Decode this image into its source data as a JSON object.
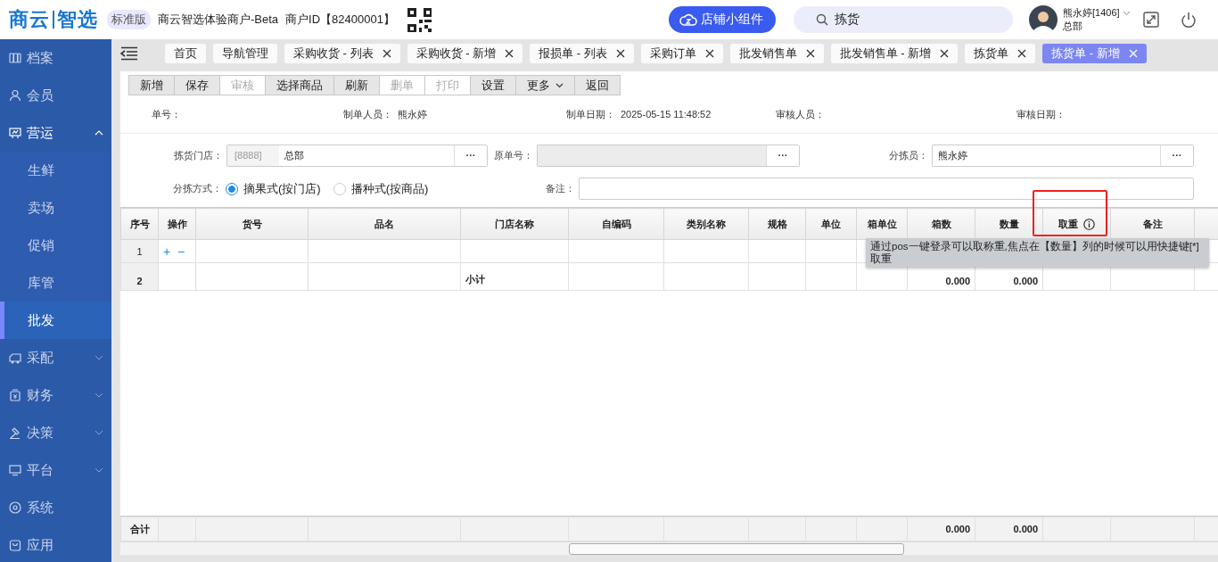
{
  "header": {
    "logo_left": "商云",
    "logo_right": "智选",
    "edition": "标准版",
    "merchant": "商云智选体验商户-Beta",
    "merchant_id": "商户ID【82400001】",
    "widget_button": "店铺小组件",
    "search": {
      "value": "拣货"
    },
    "user": {
      "name": "熊永婷[1406]",
      "org": "总部"
    }
  },
  "sidebar": {
    "items": [
      {
        "label": "档案",
        "expandable": false
      },
      {
        "label": "会员",
        "expandable": false
      },
      {
        "label": "营运",
        "expandable": true,
        "expanded": true,
        "children": [
          {
            "label": "生鲜",
            "selected": false
          },
          {
            "label": "卖场",
            "selected": false
          },
          {
            "label": "促销",
            "selected": false
          },
          {
            "label": "库管",
            "selected": false
          },
          {
            "label": "批发",
            "selected": true
          }
        ]
      },
      {
        "label": "采配",
        "expandable": true,
        "expanded": false
      },
      {
        "label": "财务",
        "expandable": true,
        "expanded": false
      },
      {
        "label": "决策",
        "expandable": true,
        "expanded": false
      },
      {
        "label": "平台",
        "expandable": true,
        "expanded": false
      },
      {
        "label": "系统",
        "expandable": false
      },
      {
        "label": "应用",
        "expandable": false
      }
    ]
  },
  "tabs": [
    {
      "label": "首页",
      "closable": false,
      "selected": false
    },
    {
      "label": "导航管理",
      "closable": false,
      "selected": false
    },
    {
      "label": "采购收货 - 列表",
      "closable": true,
      "selected": false
    },
    {
      "label": "采购收货 - 新增",
      "closable": true,
      "selected": false
    },
    {
      "label": "报损单 - 列表",
      "closable": true,
      "selected": false
    },
    {
      "label": "采购订单",
      "closable": true,
      "selected": false
    },
    {
      "label": "批发销售单",
      "closable": true,
      "selected": false
    },
    {
      "label": "批发销售单 - 新增",
      "closable": true,
      "selected": false
    },
    {
      "label": "拣货单",
      "closable": true,
      "selected": false
    },
    {
      "label": "拣货单 - 新增",
      "closable": true,
      "selected": true
    }
  ],
  "toolbar": [
    {
      "label": "新增",
      "disabled": false,
      "menu": false
    },
    {
      "label": "保存",
      "disabled": false,
      "menu": false
    },
    {
      "label": "审核",
      "disabled": true,
      "menu": false
    },
    {
      "label": "选择商品",
      "disabled": false,
      "menu": false
    },
    {
      "label": "刷新",
      "disabled": false,
      "menu": false
    },
    {
      "label": "删单",
      "disabled": true,
      "menu": false
    },
    {
      "label": "打印",
      "disabled": true,
      "menu": false
    },
    {
      "label": "设置",
      "disabled": false,
      "menu": false
    },
    {
      "label": "更多",
      "disabled": false,
      "menu": true
    },
    {
      "label": "返回",
      "disabled": false,
      "menu": false
    }
  ],
  "info": [
    {
      "label": "单号："
    },
    {
      "label": "制单人员：",
      "value": "熊永婷"
    },
    {
      "label": "制单日期：",
      "value": "2025-05-15 11:48:52"
    },
    {
      "label": "审核人员："
    },
    {
      "label": "审核日期："
    }
  ],
  "form": {
    "store": {
      "label": "拣货门店：",
      "code": "[8888]",
      "value": "总部",
      "button": "···"
    },
    "source_no": {
      "label": "原单号：",
      "disabled": true,
      "button": "···"
    },
    "picker": {
      "label": "分拣员：",
      "value": "熊永婷",
      "button": "···"
    },
    "method": {
      "label": "分拣方式：",
      "options": [
        {
          "label": "摘果式(按门店)",
          "selected": true
        },
        {
          "label": "播种式(按商品)",
          "selected": false
        }
      ]
    },
    "remark": {
      "label": "备注："
    }
  },
  "table": {
    "columns": [
      {
        "label": "序号"
      },
      {
        "label": "操作"
      },
      {
        "label": "货号"
      },
      {
        "label": "品名"
      },
      {
        "label": "门店名称"
      },
      {
        "label": "自编码"
      },
      {
        "label": "类别名称"
      },
      {
        "label": "规格"
      },
      {
        "label": "单位"
      },
      {
        "label": "箱单位"
      },
      {
        "label": "箱数"
      },
      {
        "label": "数量"
      },
      {
        "label": "取重",
        "info": true,
        "highlighted": true
      },
      {
        "label": "备注"
      }
    ],
    "rows": [
      {
        "kind": "item",
        "index": "1",
        "actions": "+ −"
      },
      {
        "kind": "subtotal",
        "index": "2",
        "store_name": "小计",
        "box_count": "0.000",
        "quantity": "0.000"
      }
    ],
    "footer": {
      "index": "合计",
      "box_count": "0.000",
      "quantity": "0.000"
    },
    "tooltip": "通过pos一键登录可以取称重,焦点在【数量】列的时候可以用快捷键[*]取重"
  }
}
